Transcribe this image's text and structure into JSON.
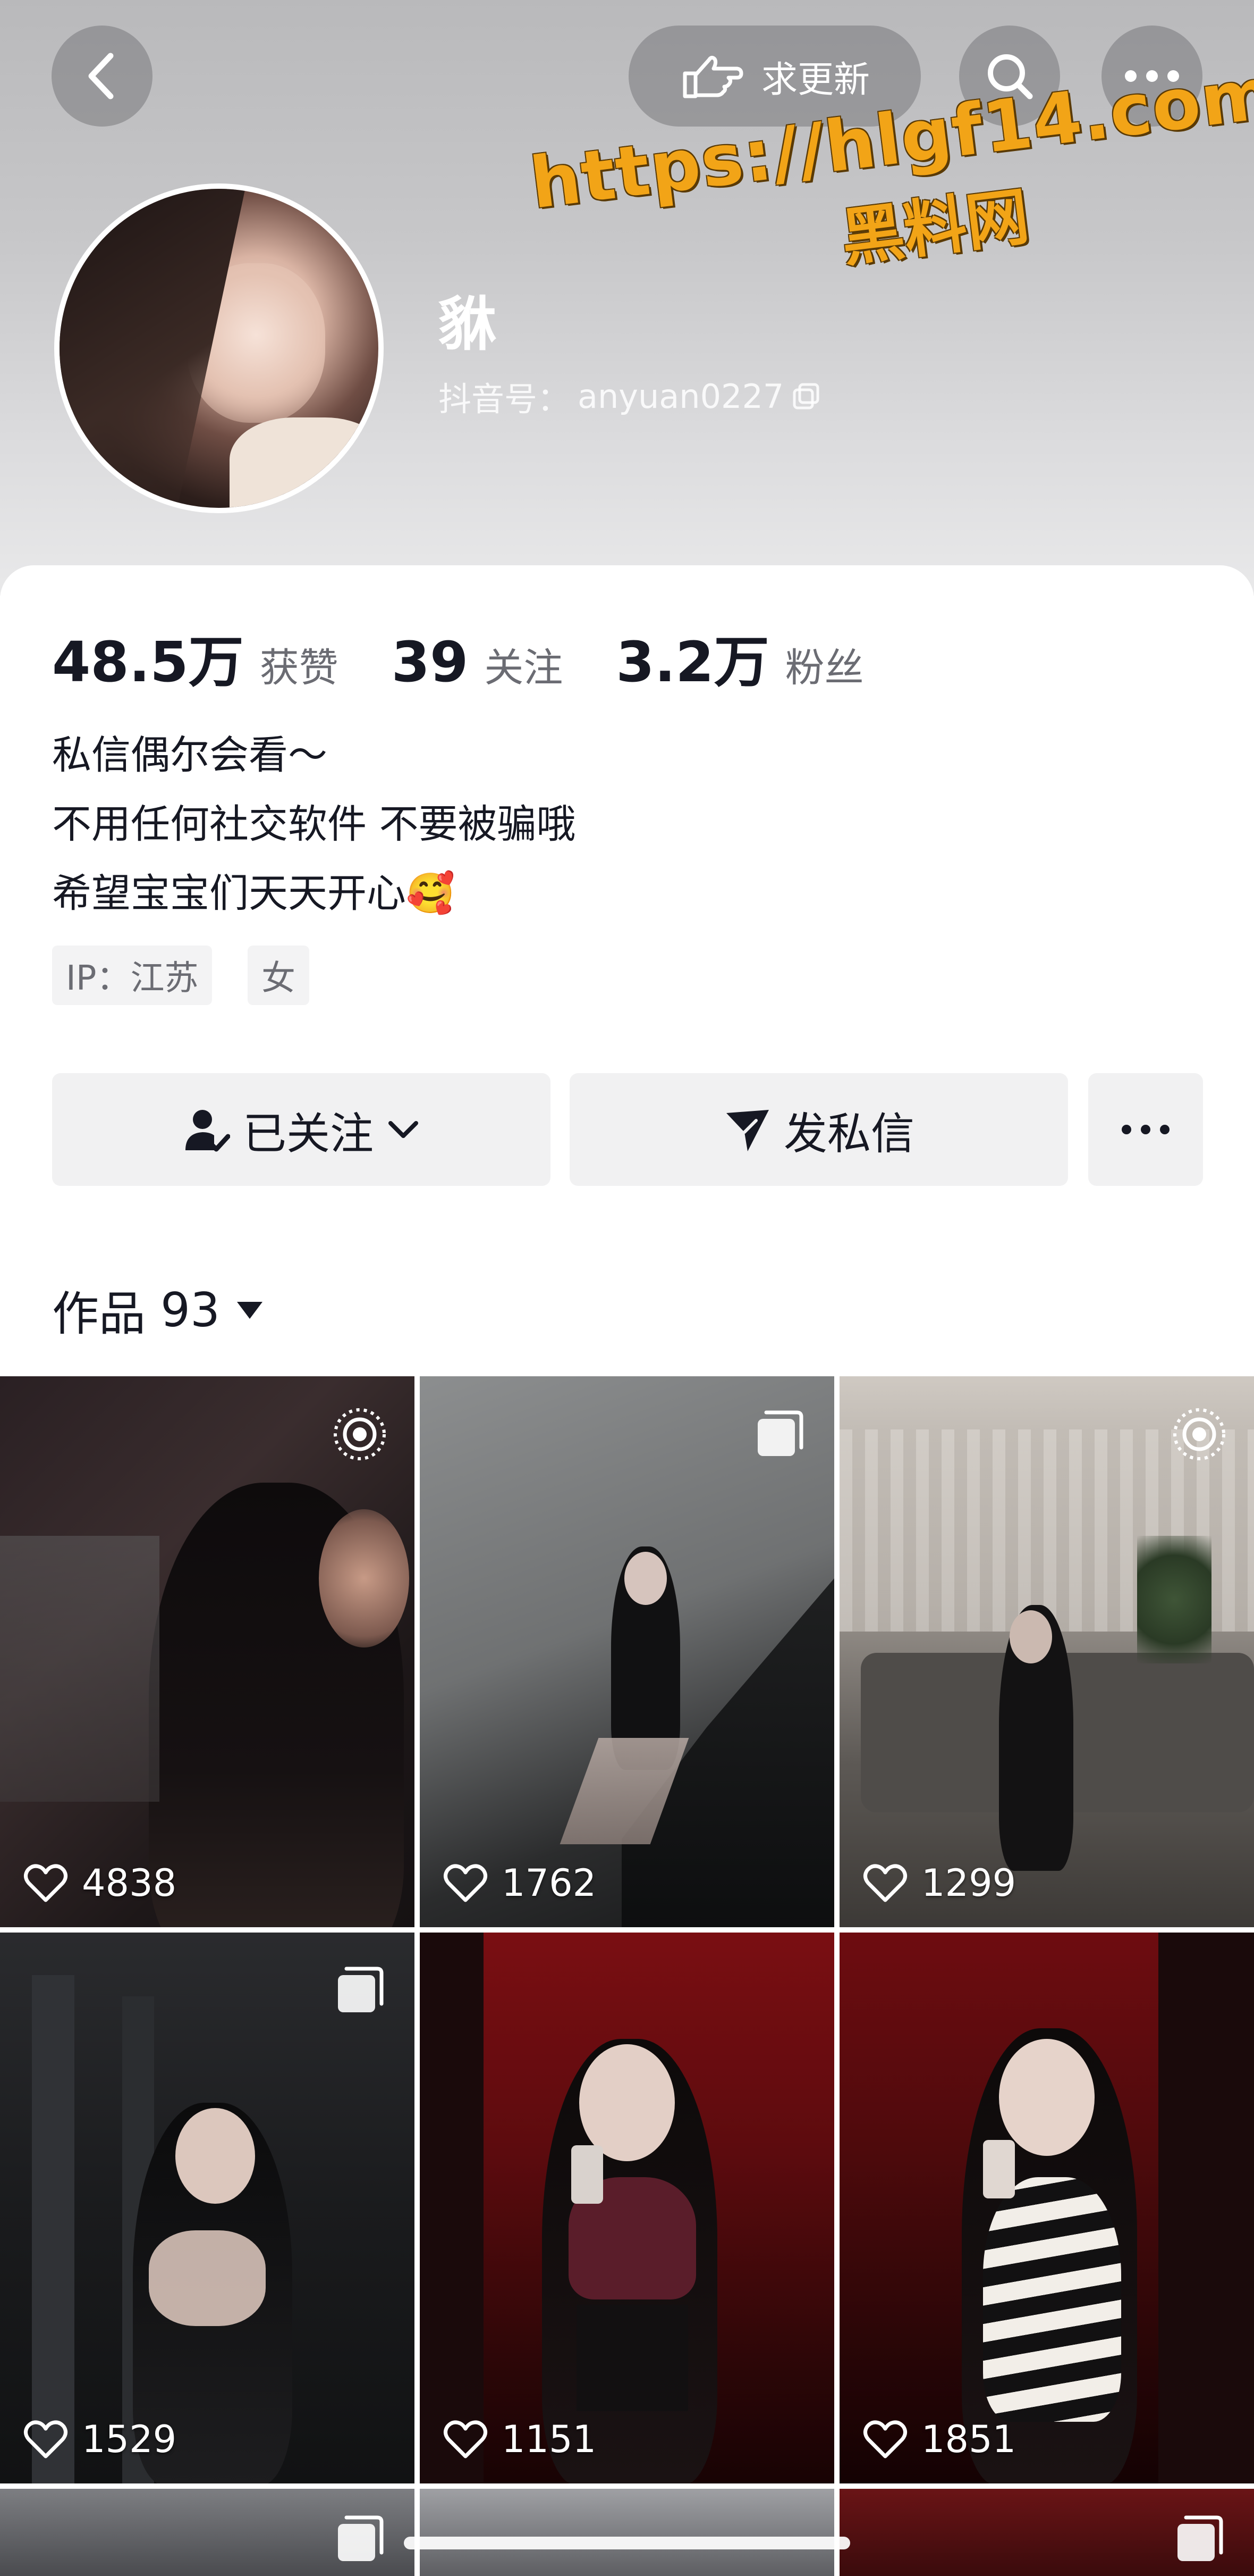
{
  "header": {
    "request_update_label": "求更新",
    "nickname": "貅",
    "account_label": "抖音号：",
    "account_id": "anyuan0227",
    "watermark_url": "https://hlgf14.com",
    "watermark_site": "黑料网"
  },
  "stats": [
    {
      "value": "48.5万",
      "label": "获赞"
    },
    {
      "value": "39",
      "label": "关注"
    },
    {
      "value": "3.2万",
      "label": "粉丝"
    }
  ],
  "bio": {
    "line1": "私信偶尔会看～",
    "line2": "不用任何社交软件 不要被骗哦",
    "line3": "希望宝宝们天天开心",
    "emoji": "🥰"
  },
  "tags": {
    "ip": "IP：江苏",
    "gender": "女"
  },
  "actions": {
    "follow_label": "已关注",
    "message_label": "发私信"
  },
  "works": {
    "label": "作品",
    "count": "93"
  },
  "grid": [
    {
      "likes": "4838",
      "badge": "live-photo-icon"
    },
    {
      "likes": "1762",
      "badge": "multi-image-icon"
    },
    {
      "likes": "1299",
      "badge": "live-photo-icon"
    },
    {
      "likes": "1529",
      "badge": "multi-image-icon"
    },
    {
      "likes": "1151",
      "badge": "none"
    },
    {
      "likes": "1851",
      "badge": "none"
    }
  ],
  "colors": {
    "accent_watermark": "#f2a417",
    "text_primary": "#161823",
    "text_secondary": "#6b6c73",
    "button_bg": "#f1f1f2"
  }
}
